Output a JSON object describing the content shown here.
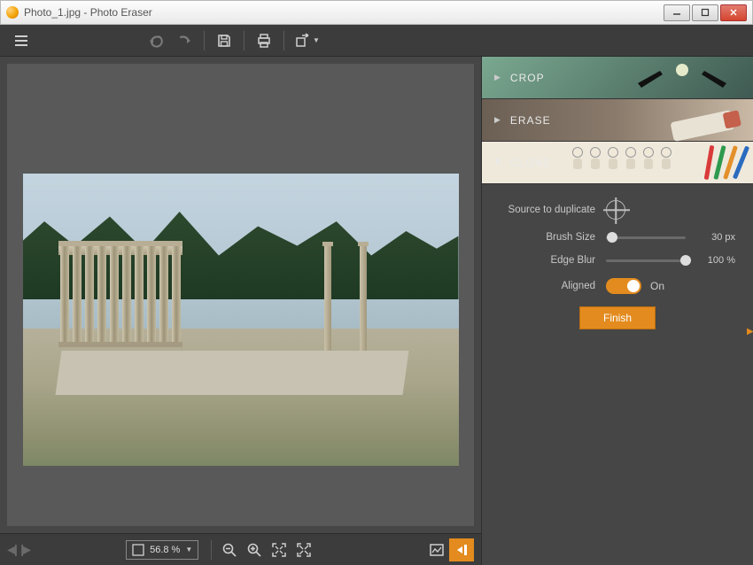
{
  "window": {
    "title": "Photo_1.jpg - Photo Eraser"
  },
  "panels": {
    "crop": {
      "label": "CROP",
      "expanded": false
    },
    "erase": {
      "label": "ERASE",
      "expanded": false
    },
    "clone": {
      "label": "CLONE",
      "expanded": true
    }
  },
  "clone": {
    "source_label": "Source to duplicate",
    "brush_size": {
      "label": "Brush Size",
      "value": 30,
      "display": "30 px",
      "pct": 8
    },
    "edge_blur": {
      "label": "Edge Blur",
      "value": 100,
      "display": "100 %",
      "pct": 100
    },
    "aligned": {
      "label": "Aligned",
      "on_label": "On",
      "value": true
    },
    "finish_label": "Finish"
  },
  "status": {
    "zoom": "56.8 %"
  },
  "colors": {
    "accent": "#e38b1e"
  }
}
